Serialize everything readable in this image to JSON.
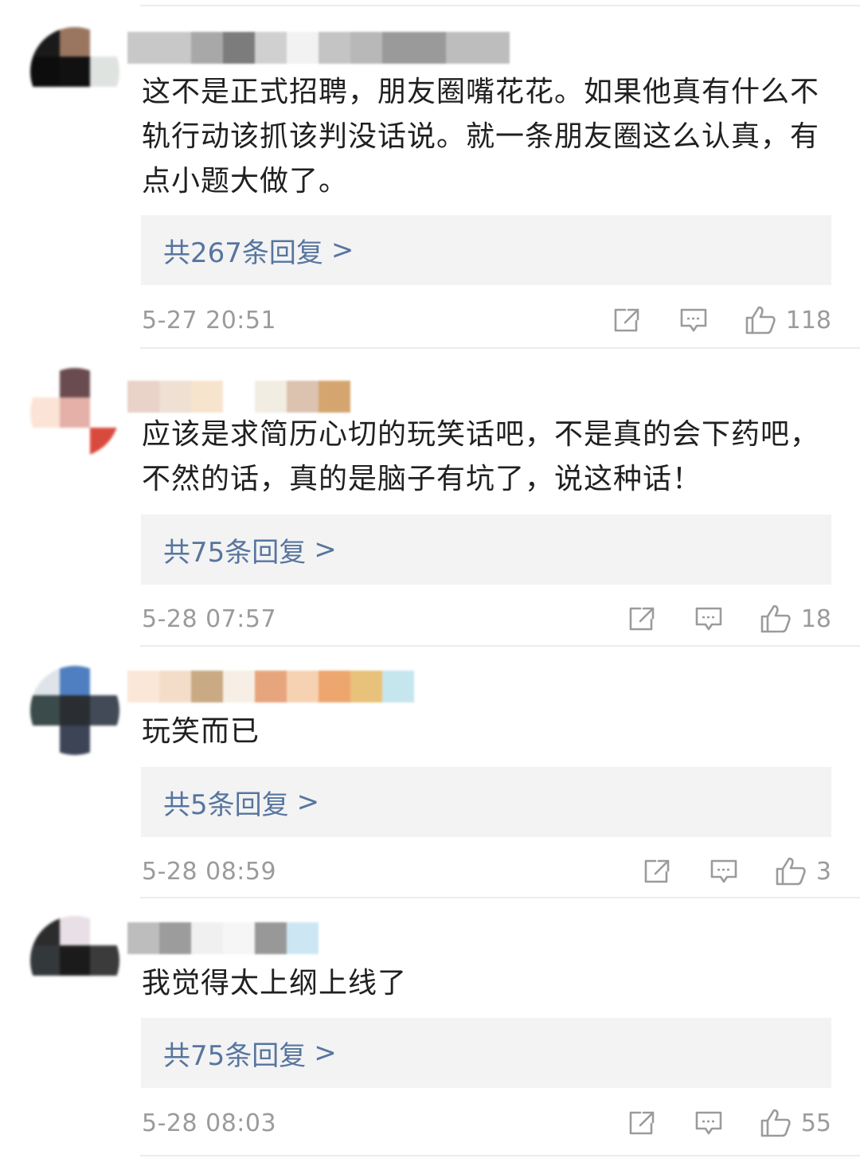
{
  "comments": [
    {
      "text": "这不是正式招聘，朋友圈嘴花花。如果他真有什么不轨行动该抓该判没话说。就一条朋友圈这么认真，有点小题大做了。",
      "reply_label": "共267条回复",
      "reply_chevron": ">",
      "timestamp": "5-27 20:51",
      "likes": "118"
    },
    {
      "text": "应该是求简历心切的玩笑话吧，不是真的会下药吧，不然的话，真的是脑子有坑了，说这种话！",
      "reply_label": "共75条回复",
      "reply_chevron": ">",
      "timestamp": "5-28 07:57",
      "likes": "18"
    },
    {
      "text": "玩笑而已",
      "reply_label": "共5条回复",
      "reply_chevron": ">",
      "timestamp": "5-28 08:59",
      "likes": "3"
    },
    {
      "text": "我觉得太上纲上线了",
      "reply_label": "共75条回复",
      "reply_chevron": ">",
      "timestamp": "5-28 08:03",
      "likes": "55"
    }
  ],
  "icons": {
    "share": "share-icon",
    "reply": "comment-icon",
    "like": "thumbs-up-icon"
  },
  "colors": {
    "link": "#57759e",
    "meta": "#9b9b9b",
    "reply_bg": "#f3f3f4"
  }
}
